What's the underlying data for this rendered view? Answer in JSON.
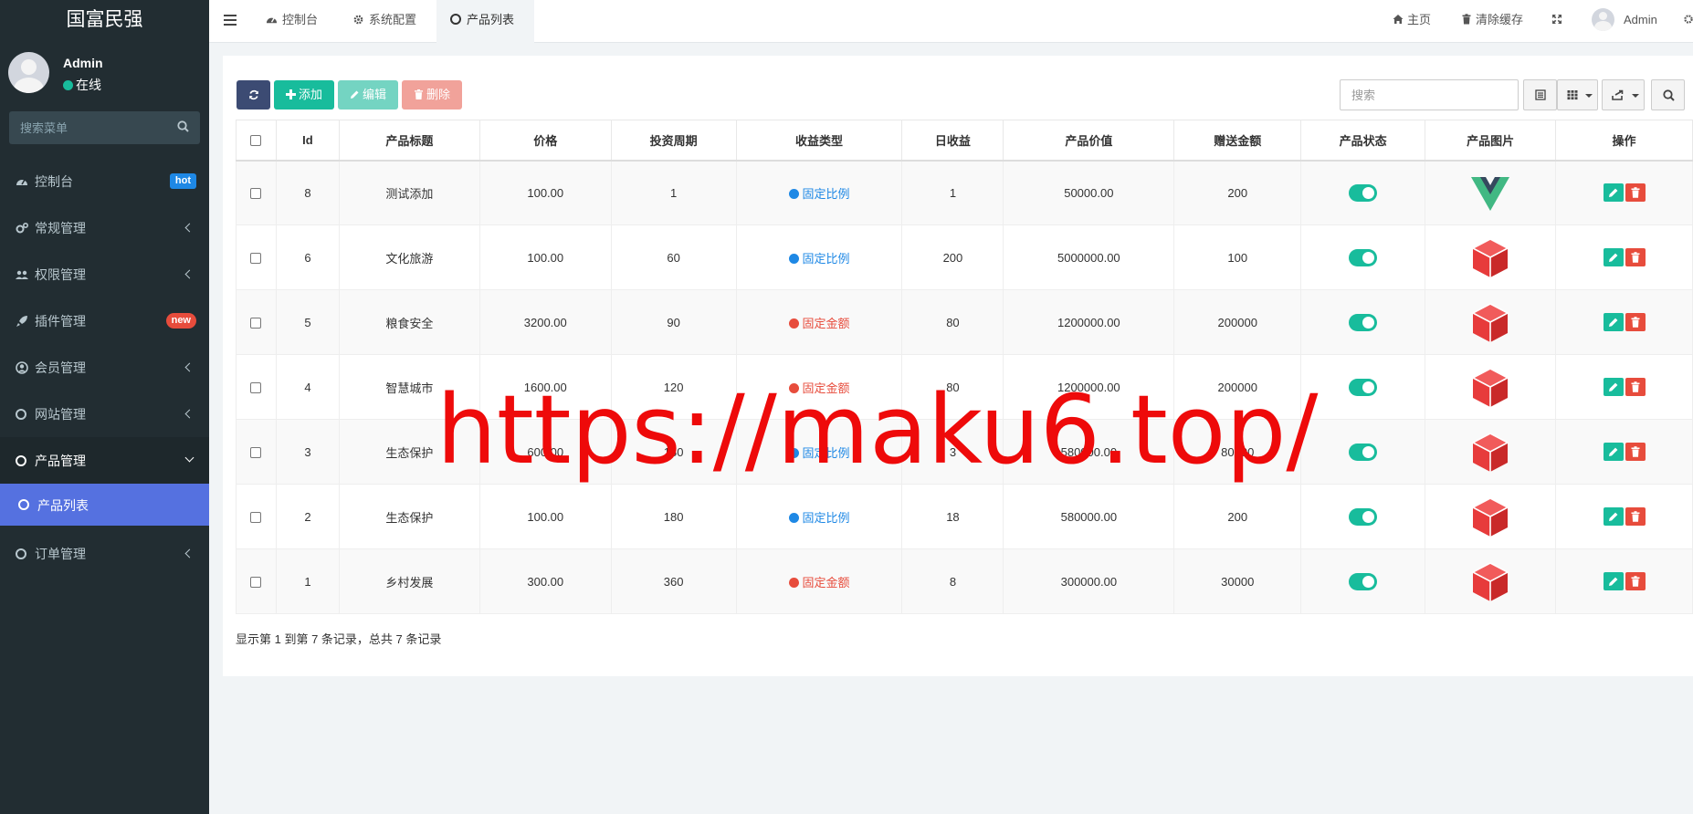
{
  "sidebar": {
    "logo": "国富民强",
    "user": {
      "name": "Admin",
      "status": "在线"
    },
    "search_placeholder": "搜索菜单",
    "items": [
      {
        "label": "控制台",
        "badge": "hot"
      },
      {
        "label": "常规管理"
      },
      {
        "label": "权限管理"
      },
      {
        "label": "插件管理",
        "badge": "new"
      },
      {
        "label": "会员管理"
      },
      {
        "label": "网站管理"
      },
      {
        "label": "产品管理"
      },
      {
        "label": "订单管理"
      }
    ],
    "submenu": {
      "label": "产品列表"
    }
  },
  "topnav": {
    "tabs": [
      {
        "label": "控制台",
        "icon": "dashboard-icon"
      },
      {
        "label": "系统配置",
        "icon": "gear-icon"
      },
      {
        "label": "产品列表",
        "icon": "circle-icon"
      }
    ],
    "home": "主页",
    "clear_cache": "清除缓存",
    "admin": "Admin"
  },
  "toolbar": {
    "add": "添加",
    "edit": "编辑",
    "delete": "删除",
    "search_placeholder": "搜索"
  },
  "table": {
    "columns": [
      "Id",
      "产品标题",
      "价格",
      "投资周期",
      "收益类型",
      "日收益",
      "产品价值",
      "赠送金额",
      "产品状态",
      "产品图片",
      "操作"
    ],
    "rows": [
      {
        "id": "8",
        "title": "测试添加",
        "price": "100.00",
        "period": "1",
        "type": "固定比例",
        "daily": "1",
        "value": "50000.00",
        "gift": "200",
        "img": "vue-logo"
      },
      {
        "id": "6",
        "title": "文化旅游",
        "price": "100.00",
        "period": "60",
        "type": "固定比例",
        "daily": "200",
        "value": "5000000.00",
        "gift": "100",
        "img": "cube"
      },
      {
        "id": "5",
        "title": "粮食安全",
        "price": "3200.00",
        "period": "90",
        "type": "固定金额",
        "daily": "80",
        "value": "1200000.00",
        "gift": "200000",
        "img": "cube"
      },
      {
        "id": "4",
        "title": "智慧城市",
        "price": "1600.00",
        "period": "120",
        "type": "固定金额",
        "daily": "80",
        "value": "1200000.00",
        "gift": "200000",
        "img": "cube"
      },
      {
        "id": "3",
        "title": "生态保护",
        "price": "600.00",
        "period": "180",
        "type": "固定比例",
        "daily": "3",
        "value": "580000.00",
        "gift": "80000",
        "img": "cube"
      },
      {
        "id": "2",
        "title": "生态保护",
        "price": "100.00",
        "period": "180",
        "type": "固定比例",
        "daily": "18",
        "value": "580000.00",
        "gift": "200",
        "img": "cube"
      },
      {
        "id": "1",
        "title": "乡村发展",
        "price": "300.00",
        "period": "360",
        "type": "固定金额",
        "daily": "8",
        "value": "300000.00",
        "gift": "30000",
        "img": "cube"
      }
    ]
  },
  "pagination_info": "显示第 1 到第 7 条记录，总共 7 条记录",
  "watermark": "https://maku6.top/",
  "colors": {
    "sidebar_bg": "#222d32",
    "accent": "#5571e0",
    "success": "#18bc9c",
    "danger": "#e74c3c",
    "ratio_blue": "#1e88e5",
    "amount_red": "#e74c3c"
  }
}
